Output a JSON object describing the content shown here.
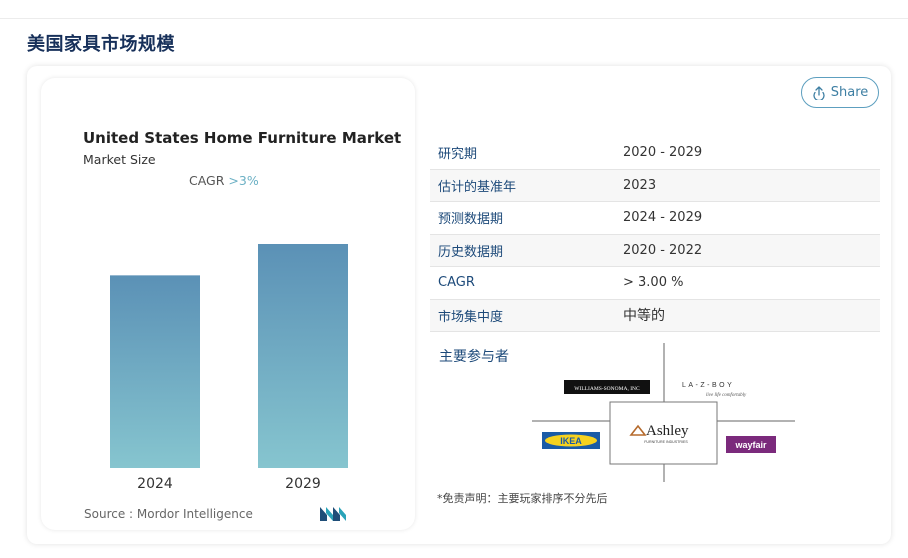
{
  "page": {
    "title": "美国家具市场规模"
  },
  "chart_panel": {
    "title": "United States Home Furniture Market",
    "subtitle": "Market Size",
    "cagr_prefix": "CAGR",
    "cagr_value": ">3%",
    "source": "Source :  Mordor Intelligence"
  },
  "chart_data": {
    "type": "bar",
    "title": "United States Home Furniture Market",
    "subtitle": "Market Size",
    "categories": [
      "2024",
      "2029"
    ],
    "values": [
      0.86,
      1.0
    ],
    "value_note": "relative bar heights; no value axis shown",
    "grid": false,
    "legend": false,
    "colors": {
      "bar_top": "#5b91b6",
      "bar_bottom": "#86c5cf"
    }
  },
  "share": {
    "label": "Share"
  },
  "info_table": [
    {
      "key": "研究期",
      "value": "2020 - 2029"
    },
    {
      "key": "估计的基准年",
      "value": "2023"
    },
    {
      "key": "预测数据期",
      "value": "2024 - 2029"
    },
    {
      "key": "历史数据期",
      "value": "2020 - 2022"
    },
    {
      "key": "CAGR",
      "value": "> 3.00 %"
    },
    {
      "key": "市场集中度",
      "value": "中等的"
    }
  ],
  "players": {
    "heading": "主要参与者",
    "logos": [
      "WILLIAMS-SONOMA, INC",
      "LA-Z-BOY",
      "Ashley",
      "IKEA",
      "wayfair"
    ],
    "lazboy_tagline": "live life comfortably",
    "ashley_tagline": "FURNITURE INDUSTRIES"
  },
  "disclaimer": "*免责声明：主要玩家排序不分先后"
}
